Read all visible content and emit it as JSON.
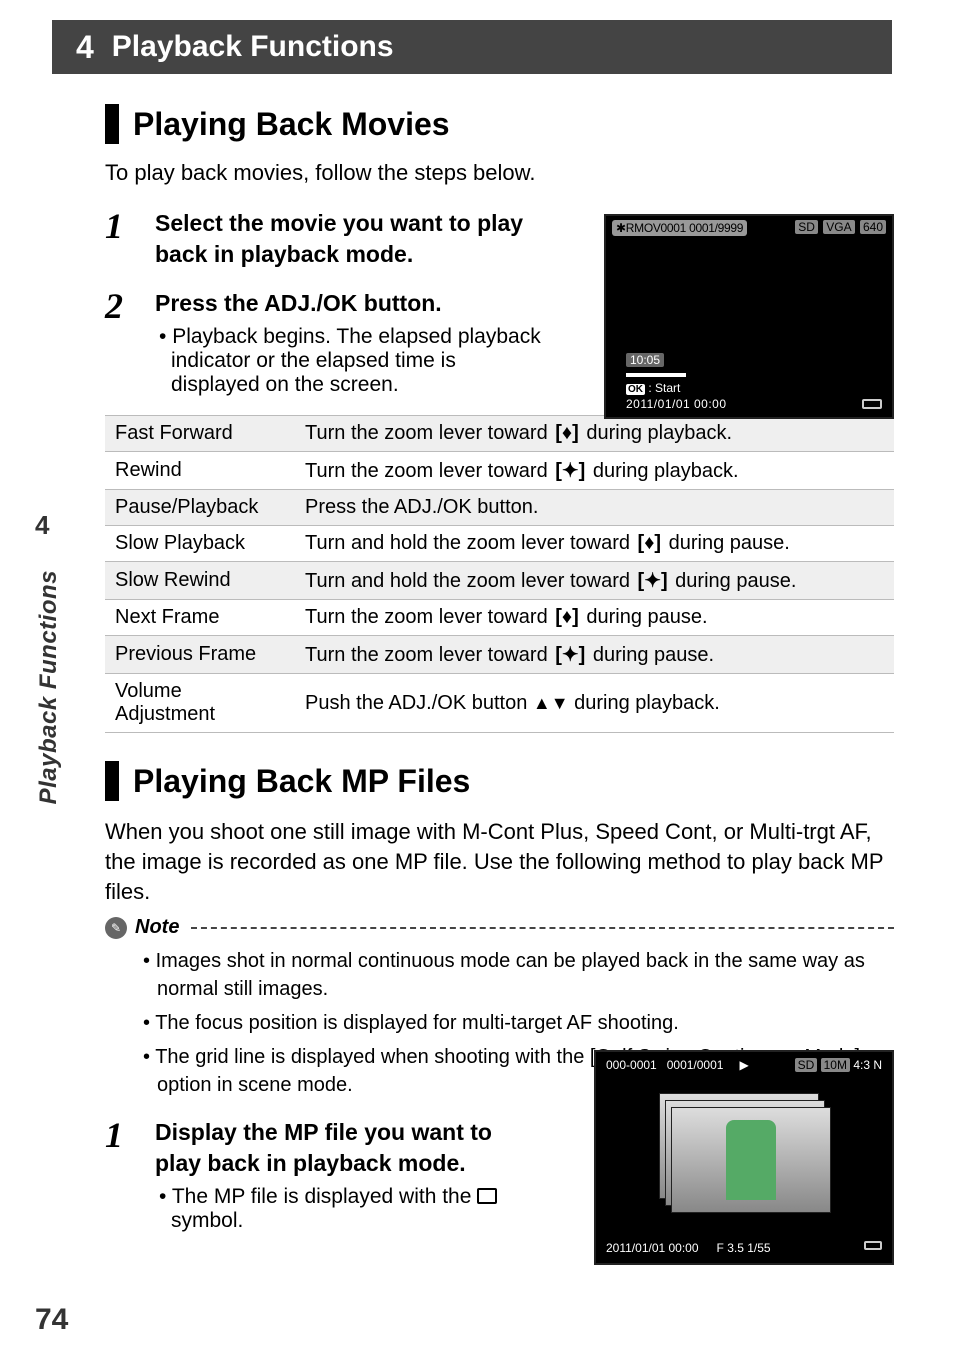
{
  "side": {
    "num": "4",
    "label": "Playback Functions"
  },
  "chapter": {
    "num": "4",
    "title": "Playback Functions"
  },
  "section1": {
    "title": "Playing Back Movies",
    "intro": "To play back movies, follow the steps below.",
    "step1": {
      "num": "1",
      "title": "Select the movie you want to play back in playback mode."
    },
    "step2": {
      "num": "2",
      "title": "Press the ADJ./OK button.",
      "bullet": "Playback begins. The elapsed playback indicator or the elapsed time is displayed on the screen."
    }
  },
  "shot1": {
    "tag": "✱RMOV0001 0001/9999",
    "sd": "SD",
    "vga": "VGA",
    "res": "640",
    "time": "10:05",
    "ok": "OK",
    "start": ": Start",
    "date": "2011/01/01 00:00"
  },
  "table": {
    "rows": [
      {
        "name": "Fast Forward",
        "desc_pre": "Turn the zoom lever toward ",
        "icon": "tele",
        "desc_post": " during playback."
      },
      {
        "name": "Rewind",
        "desc_pre": "Turn the zoom lever toward ",
        "icon": "wide",
        "desc_post": " during playback."
      },
      {
        "name": "Pause/Playback",
        "desc_pre": "Press the ADJ./OK button.",
        "icon": "",
        "desc_post": ""
      },
      {
        "name": "Slow Playback",
        "desc_pre": "Turn and hold the zoom lever toward ",
        "icon": "tele",
        "desc_post": " during pause."
      },
      {
        "name": "Slow Rewind",
        "desc_pre": "Turn and hold the zoom lever toward ",
        "icon": "wide",
        "desc_post": " during pause."
      },
      {
        "name": "Next Frame",
        "desc_pre": "Turn the zoom lever toward ",
        "icon": "tele",
        "desc_post": " during pause."
      },
      {
        "name": "Previous Frame",
        "desc_pre": "Turn the zoom lever toward ",
        "icon": "wide",
        "desc_post": " during pause."
      },
      {
        "name": "Volume Adjustment",
        "desc_pre": "Push the ADJ./OK button ",
        "icon": "updown",
        "desc_post": " during playback."
      }
    ]
  },
  "section2": {
    "title": "Playing Back MP Files",
    "intro": "When you shoot one still image with M-Cont Plus, Speed Cont, or Multi-trgt AF, the image is recorded as one MP file. Use the following method to play back MP files.",
    "note_label": "Note",
    "notes": [
      "Images shot in normal continuous mode can be played back in the same way as normal still images.",
      "The focus position is displayed for multi-target AF shooting.",
      "The grid line is displayed when shooting with the [Golf Swing Continuous Mode] option in scene mode."
    ],
    "step1": {
      "num": "1",
      "title": "Display the MP file you want to play back in playback mode.",
      "bullet_pre": "The MP file is displayed with the ",
      "bullet_post": " symbol."
    }
  },
  "shot2": {
    "file": "000-0001",
    "idx": "0001/0001",
    "sd": "SD",
    "size": "10M",
    "ratio": "4:3 N",
    "date": "2011/01/01 00:00",
    "exp": "F 3.5 1/55"
  },
  "page_num": "74"
}
